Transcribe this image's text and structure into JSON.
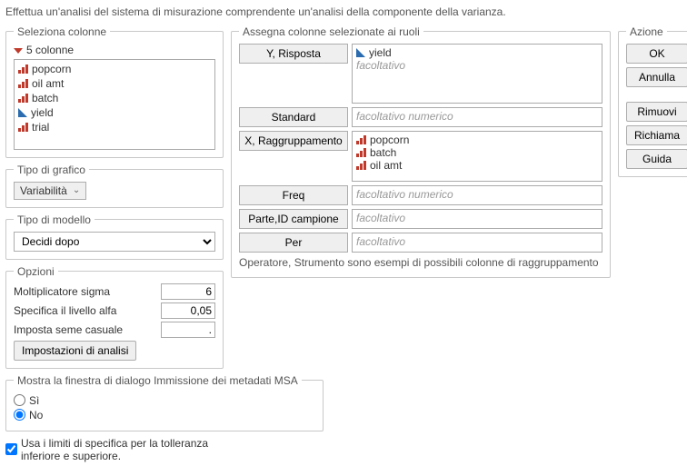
{
  "description": "Effettua un'analisi del sistema di misurazione comprendente un'analisi della componente della varianza.",
  "selectColumns": {
    "legend": "Seleziona colonne",
    "countLabel": "5 colonne",
    "items": [
      {
        "name": "popcorn",
        "icon": "bars"
      },
      {
        "name": "oil amt",
        "icon": "bars"
      },
      {
        "name": "batch",
        "icon": "bars"
      },
      {
        "name": "yield",
        "icon": "tri"
      },
      {
        "name": "trial",
        "icon": "bars"
      }
    ]
  },
  "chartType": {
    "legend": "Tipo di grafico",
    "value": "Variabilità"
  },
  "modelType": {
    "legend": "Tipo di modello",
    "value": "Decidi dopo"
  },
  "options": {
    "legend": "Opzioni",
    "sigmaLabel": "Moltiplicatore sigma",
    "sigmaValue": "6",
    "alphaLabel": "Specifica il livello alfa",
    "alphaValue": "0,05",
    "seedLabel": "Imposta seme casuale",
    "seedValue": ".",
    "analysisSettings": "Impostazioni di analisi"
  },
  "msa": {
    "legend": "Mostra la finestra di dialogo Immissione dei metadati MSA",
    "yes": "Sì",
    "no": "No",
    "selected": "no"
  },
  "specLimits": "Usa i limiti di specifica per la tolleranza inferiore e superiore.",
  "roles": {
    "legend": "Assegna colonne selezionate ai ruoli",
    "yLabel": "Y, Risposta",
    "yValue": "yield",
    "yPlaceholder": "facoltativo",
    "standardLabel": "Standard",
    "standardPlaceholder": "facoltativo numerico",
    "xLabel": "X, Raggruppamento",
    "xValues": [
      "popcorn",
      "batch",
      "oil amt"
    ],
    "freqLabel": "Freq",
    "freqPlaceholder": "facoltativo numerico",
    "partLabel": "Parte,ID campione",
    "partPlaceholder": "facoltativo",
    "perLabel": "Per",
    "perPlaceholder": "facoltativo",
    "note": "Operatore, Strumento sono esempi di possibili colonne di raggruppamento"
  },
  "actions": {
    "legend": "Azione",
    "ok": "OK",
    "cancel": "Annulla",
    "remove": "Rimuovi",
    "recall": "Richiama",
    "help": "Guida"
  }
}
